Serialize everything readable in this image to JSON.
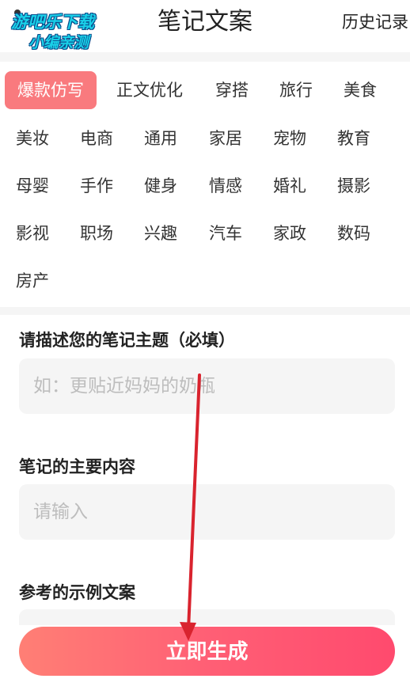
{
  "header": {
    "watermark_line1": "游吧乐下载",
    "watermark_line2": "小编亲测",
    "title": "笔记文案",
    "history_label": "历史记录"
  },
  "tags": {
    "active_index": 0,
    "items": [
      "爆款仿写",
      "正文优化",
      "穿搭",
      "旅行",
      "美食",
      "美妆",
      "电商",
      "通用",
      "家居",
      "宠物",
      "教育",
      "母婴",
      "手作",
      "健身",
      "情感",
      "婚礼",
      "摄影",
      "影视",
      "职场",
      "兴趣",
      "汽车",
      "家政",
      "数码",
      "房产"
    ]
  },
  "form": {
    "topic_label": "请描述您的笔记主题（必填）",
    "topic_placeholder": "如：更贴近妈妈的奶瓶",
    "content_label": "笔记的主要内容",
    "content_placeholder": "请输入",
    "example_label": "参考的示例文案"
  },
  "actions": {
    "generate_label": "立即生成"
  },
  "colors": {
    "accent": "#f97a7e",
    "button_start": "#ff7f75",
    "button_end": "#ff4a6e",
    "annotation_arrow": "#d9232e"
  }
}
